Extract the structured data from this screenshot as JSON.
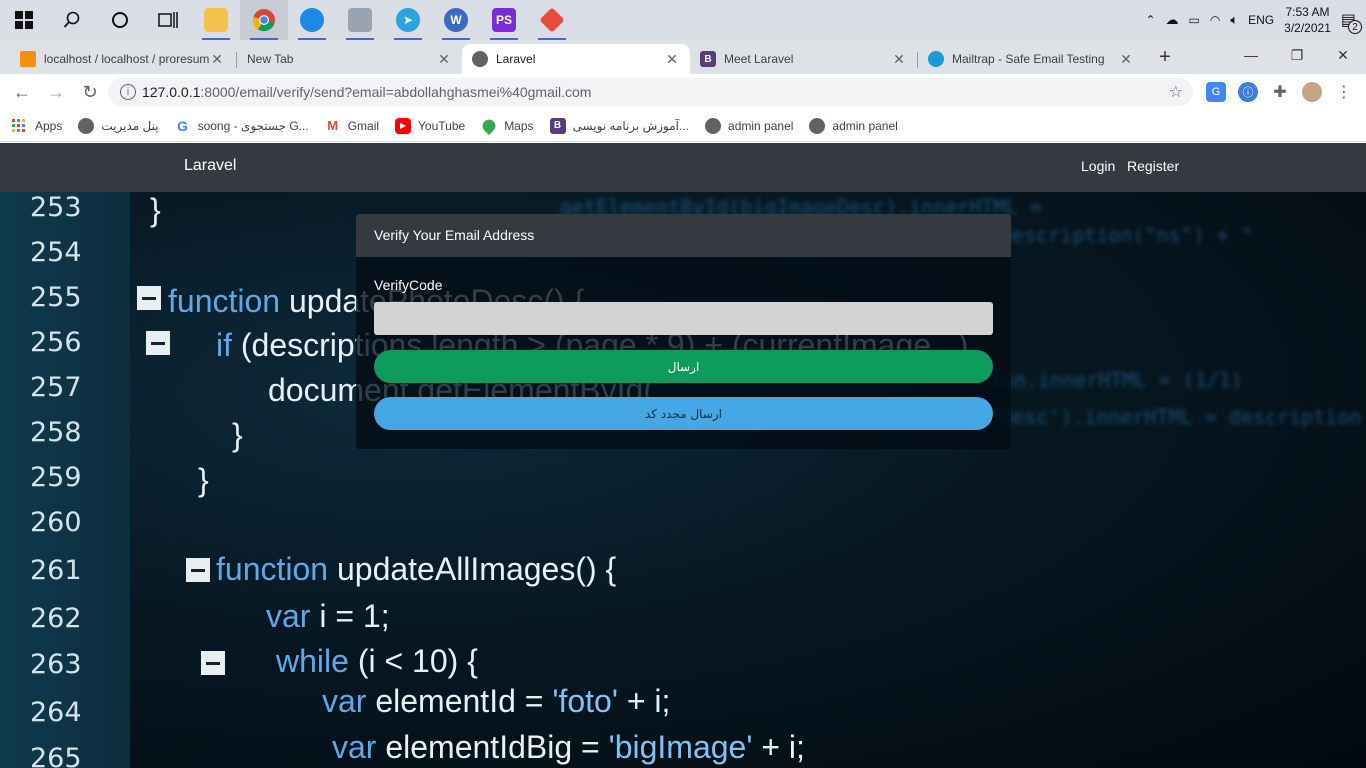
{
  "taskbar": {
    "apps": [
      {
        "name": "windows-start",
        "color": "#ffffff"
      },
      {
        "name": "search",
        "color": "#ffffff"
      },
      {
        "name": "cortana",
        "color": "#ffffff"
      },
      {
        "name": "task-view",
        "color": "#ffffff"
      },
      {
        "name": "file-explorer",
        "color": "#f3c24a"
      },
      {
        "name": "chrome",
        "color": "#db4437"
      },
      {
        "name": "app-blue",
        "color": "#1e88e5"
      },
      {
        "name": "app-monitor",
        "color": "#9aa4b1"
      },
      {
        "name": "telegram",
        "color": "#2aa3df"
      },
      {
        "name": "wamp",
        "color": "#3a6bc1"
      },
      {
        "name": "phpstorm",
        "color": "#8a2be2"
      },
      {
        "name": "git",
        "color": "#e84e3b"
      }
    ],
    "tray": {
      "language": "ENG",
      "time": "7:53 AM",
      "date": "3/2/2021",
      "notifications": "2"
    }
  },
  "tabs": [
    {
      "title": "localhost / localhost / proresum",
      "active": false,
      "icon_color": "#f29111"
    },
    {
      "title": "New Tab",
      "active": false,
      "icon_color": ""
    },
    {
      "title": "Laravel",
      "active": true,
      "icon_color": "#5f6368"
    },
    {
      "title": "Meet Laravel",
      "active": false,
      "icon_color": "#563d7c",
      "icon_text": "B"
    },
    {
      "title": "Mailtrap - Safe Email Testing",
      "active": false,
      "icon_color": "#1a9bd7"
    }
  ],
  "omnibox": {
    "host": "127.0.0.1",
    "rest": ":8000/email/verify/send?email=abdollahghasmei%40gmail.com"
  },
  "bookmarks": [
    {
      "label": "Apps",
      "icon": "apps-grid-icon",
      "color": "#4285f4"
    },
    {
      "label": "پنل مدیریت",
      "icon": "globe-icon",
      "color": "#5f6368"
    },
    {
      "label": "soong - جستجوی G...",
      "icon": "google-icon",
      "color": "#4285f4",
      "glyph": "G"
    },
    {
      "label": "Gmail",
      "icon": "gmail-icon",
      "color": "#ea4335",
      "glyph": "M"
    },
    {
      "label": "YouTube",
      "icon": "youtube-icon",
      "color": "#ff0000",
      "glyph": "▶"
    },
    {
      "label": "Maps",
      "icon": "maps-icon",
      "color": "#34a853",
      "glyph": "⬤"
    },
    {
      "label": "آموزش برنامه نویسی...",
      "icon": "bootstrap-icon",
      "color": "#563d7c",
      "glyph": "B"
    },
    {
      "label": "admin panel",
      "icon": "globe-icon",
      "color": "#5f6368"
    },
    {
      "label": "admin panel",
      "icon": "globe-icon",
      "color": "#5f6368"
    }
  ],
  "navbar": {
    "brand": "Laravel",
    "login": "Login",
    "register": "Register"
  },
  "card": {
    "header": "Verify Your Email Address",
    "label": "VerifyCode",
    "input_value": "",
    "submit": "ارسال",
    "resend": "ارسال مجدد کد"
  },
  "background_code": {
    "line_numbers": [
      "253",
      "254",
      "255",
      "256",
      "257",
      "258",
      "259",
      "260",
      "261",
      "262",
      "263",
      "264",
      "265"
    ],
    "lines": [
      {
        "text": "}"
      },
      {
        "text": ""
      },
      {
        "kw": "function",
        "text": " updatePhotoDesc() {"
      },
      {
        "kw": "if",
        "text": " (descriptions.length > (page * 9) + (currentImage...)"
      },
      {
        "text": "document.getElementById("
      },
      {
        "text": "}"
      },
      {
        "text": "}"
      },
      {
        "text": ""
      },
      {
        "kw": "function",
        "text": " updateAllImages() {"
      },
      {
        "kw": "var",
        "text": " i = 1;"
      },
      {
        "kw": "while",
        "text": " (i < 10) {"
      },
      {
        "kw": "var",
        "text": " elementId = ",
        "str": "'foto'",
        "tail": " + i;"
      },
      {
        "kw": "var",
        "text": " elementIdBig = ",
        "str": "'bigImage'",
        "tail": " + i;"
      }
    ]
  }
}
